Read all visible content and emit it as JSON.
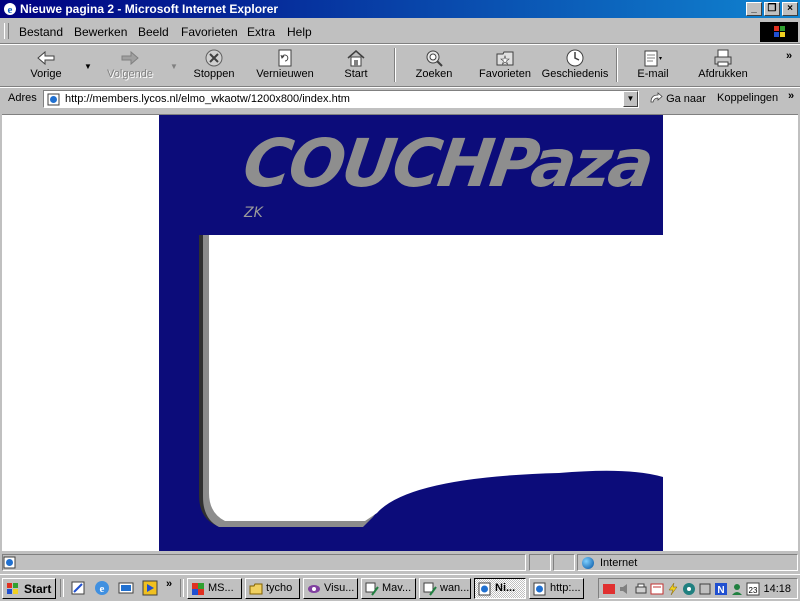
{
  "window": {
    "title": "Nieuwe pagina 2 - Microsoft Internet Explorer"
  },
  "menu": {
    "items": [
      "Bestand",
      "Bewerken",
      "Beeld",
      "Favorieten",
      "Extra",
      "Help"
    ]
  },
  "toolbar": {
    "back": "Vorige",
    "forward": "Volgende",
    "stop": "Stoppen",
    "refresh": "Vernieuwen",
    "home": "Start",
    "search": "Zoeken",
    "favorites": "Favorieten",
    "history": "Geschiedenis",
    "mail": "E-mail",
    "print": "Afdrukken"
  },
  "address": {
    "label": "Adres",
    "url": "http://members.lycos.nl/elmo_wkaotw/1200x800/index.htm",
    "go": "Ga naar",
    "links": "Koppelingen"
  },
  "page": {
    "banner_text": "COUCHPaza",
    "tag": "ZK",
    "banner_color": "#0c0c7a"
  },
  "status": {
    "zone": "Internet"
  },
  "taskbar": {
    "start": "Start",
    "tasks": [
      "MS...",
      "tycho",
      "Visu...",
      "Mav...",
      "wan...",
      "Ni...",
      "http:..."
    ],
    "active_task": "Ni...",
    "clock": "14:18"
  }
}
